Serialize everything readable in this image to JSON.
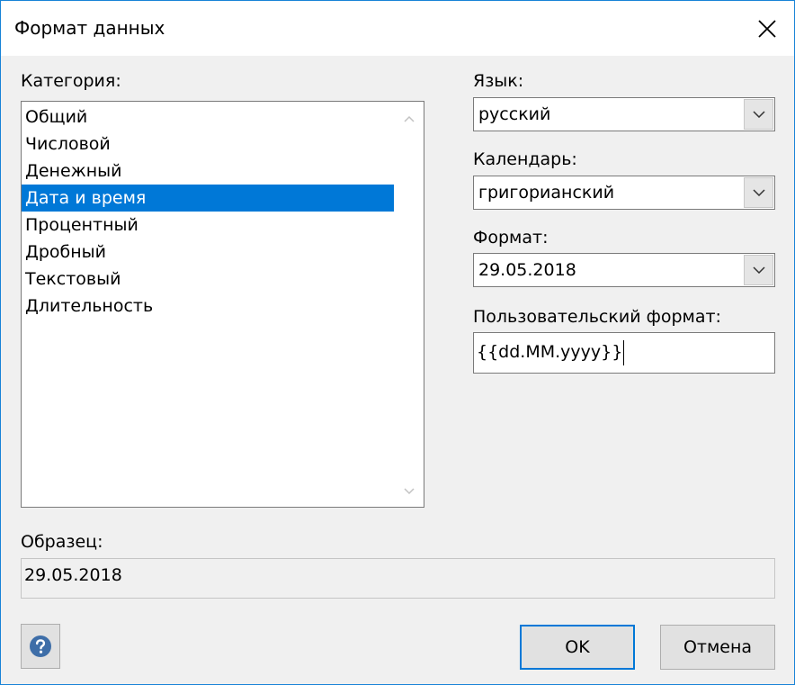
{
  "window": {
    "title": "Формат данных"
  },
  "category": {
    "label": "Категория:",
    "items": [
      "Общий",
      "Числовой",
      "Денежный",
      "Дата и время",
      "Процентный",
      "Дробный",
      "Текстовый",
      "Длительность"
    ],
    "selected_index": 3
  },
  "language": {
    "label": "Язык:",
    "value": "русский"
  },
  "calendar": {
    "label": "Календарь:",
    "value": "григорианский"
  },
  "format": {
    "label": "Формат:",
    "value": "29.05.2018"
  },
  "custom_format": {
    "label": "Пользовательский формат:",
    "value": "{{dd.MM.yyyy}}"
  },
  "sample": {
    "label": "Образец:",
    "value": "29.05.2018"
  },
  "buttons": {
    "help_icon": "question-icon",
    "ok": "OK",
    "cancel": "Отмена"
  },
  "colors": {
    "selection": "#0078d7",
    "window_border": "#1883d7",
    "help_icon": "#3e6ea8"
  }
}
